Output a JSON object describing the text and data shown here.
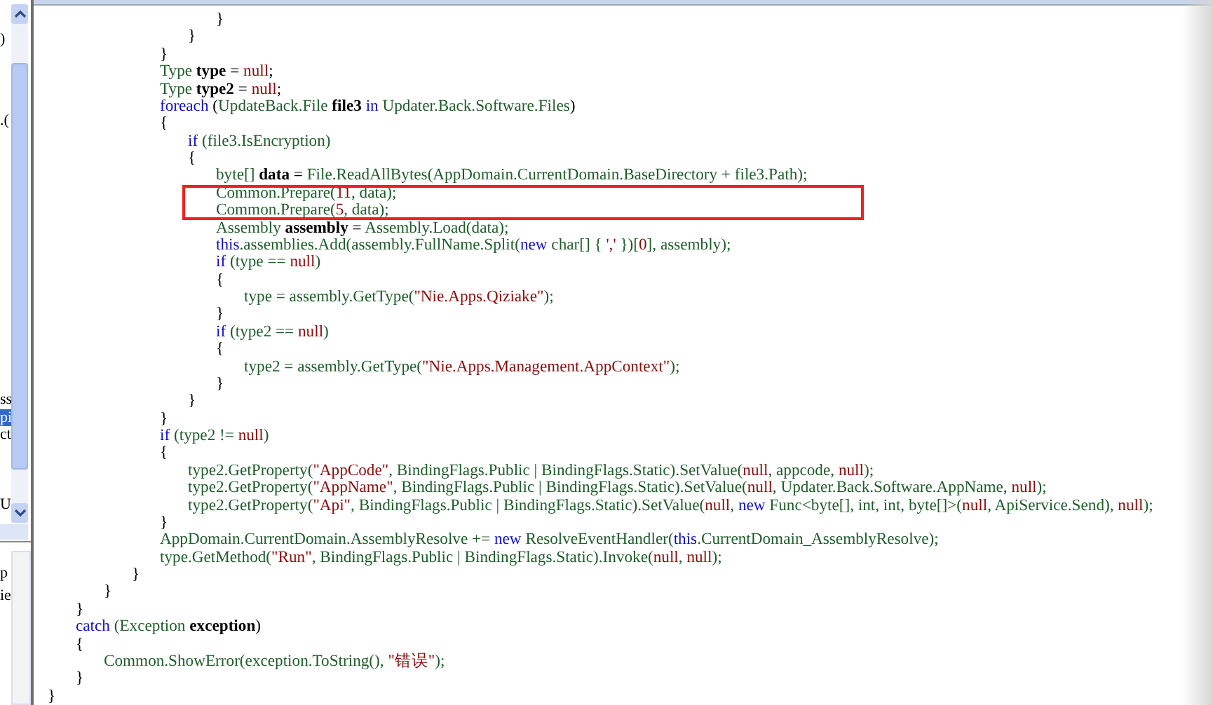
{
  "left_pane": {
    "fragments": [
      {
        "text": ")",
        "selected": false
      },
      {
        "text": ".(",
        "selected": false
      },
      {
        "text": "ss",
        "selected": false
      },
      {
        "text": "pi",
        "selected": true
      },
      {
        "text": "ct",
        "selected": false
      },
      {
        "text": "U",
        "selected": false
      }
    ]
  },
  "lower_pane": {
    "fragments": [
      {
        "text": "p"
      },
      {
        "text": "ie"
      }
    ]
  },
  "code": {
    "lines": [
      [
        {
          "t": "\t\t\t\t\t\t}",
          "kind": "plain"
        }
      ],
      [
        {
          "t": "\t\t\t\t\t}",
          "kind": "plain"
        }
      ],
      [
        {
          "t": "\t\t\t\t}",
          "kind": "plain"
        }
      ],
      [
        {
          "t": "\t\t\t\tType ",
          "kind": "ident"
        },
        {
          "t": "type",
          "kind": "decl"
        },
        {
          "t": " = ",
          "kind": "plain"
        },
        {
          "t": "null",
          "kind": "literal"
        },
        {
          "t": ";",
          "kind": "plain"
        }
      ],
      [
        {
          "t": "\t\t\t\tType ",
          "kind": "ident"
        },
        {
          "t": "type2",
          "kind": "decl"
        },
        {
          "t": " = ",
          "kind": "plain"
        },
        {
          "t": "null",
          "kind": "literal"
        },
        {
          "t": ";",
          "kind": "plain"
        }
      ],
      [
        {
          "t": "\t\t\t\tforeach",
          "kind": "keyword"
        },
        {
          "t": " (",
          "kind": "plain"
        },
        {
          "t": "UpdateBack.File ",
          "kind": "ident"
        },
        {
          "t": "file3 ",
          "kind": "decl"
        },
        {
          "t": "in ",
          "kind": "keyword"
        },
        {
          "t": "Updater.Back.Software.Files",
          "kind": "ident"
        },
        {
          "t": ")",
          "kind": "plain"
        }
      ],
      [
        {
          "t": "\t\t\t\t{",
          "kind": "plain"
        }
      ],
      [
        {
          "t": "\t\t\t\t\tif",
          "kind": "keyword"
        },
        {
          "t": " (file3.IsEncryption)",
          "kind": "ident"
        }
      ],
      [
        {
          "t": "\t\t\t\t\t{",
          "kind": "plain"
        }
      ],
      [
        {
          "t": "\t\t\t\t\t\tbyte[] ",
          "kind": "ident"
        },
        {
          "t": "data",
          "kind": "decl"
        },
        {
          "t": " = ",
          "kind": "plain"
        },
        {
          "t": "File.ReadAllBytes(AppDomain.CurrentDomain.BaseDirectory + file3.Path);",
          "kind": "ident"
        }
      ],
      [
        {
          "t": "\t\t\t\t\t\tCommon.Prepare(",
          "kind": "ident"
        },
        {
          "t": "11",
          "kind": "literal"
        },
        {
          "t": ", data);",
          "kind": "ident"
        }
      ],
      [
        {
          "t": "\t\t\t\t\t\tCommon.Prepare(",
          "kind": "ident"
        },
        {
          "t": "5",
          "kind": "literal"
        },
        {
          "t": ", data);",
          "kind": "ident"
        }
      ],
      [
        {
          "t": "\t\t\t\t\t\tAssembly ",
          "kind": "ident"
        },
        {
          "t": "assembly",
          "kind": "decl"
        },
        {
          "t": " = ",
          "kind": "plain"
        },
        {
          "t": "Assembly.Load(data);",
          "kind": "ident"
        }
      ],
      [
        {
          "t": "\t\t\t\t\t\tthis",
          "kind": "keyword"
        },
        {
          "t": ".assemblies.Add(assembly.FullName.Split(",
          "kind": "ident"
        },
        {
          "t": "new",
          "kind": "keyword"
        },
        {
          "t": " char[] { ",
          "kind": "ident"
        },
        {
          "t": "','",
          "kind": "literal"
        },
        {
          "t": " })[",
          "kind": "ident"
        },
        {
          "t": "0",
          "kind": "literal"
        },
        {
          "t": "], assembly);",
          "kind": "ident"
        }
      ],
      [
        {
          "t": "\t\t\t\t\t\tif",
          "kind": "keyword"
        },
        {
          "t": " (type == ",
          "kind": "ident"
        },
        {
          "t": "null",
          "kind": "literal"
        },
        {
          "t": ")",
          "kind": "ident"
        }
      ],
      [
        {
          "t": "\t\t\t\t\t\t{",
          "kind": "plain"
        }
      ],
      [
        {
          "t": "\t\t\t\t\t\t\ttype = assembly.GetType(",
          "kind": "ident"
        },
        {
          "t": "\"Nie.Apps.Qiziake\"",
          "kind": "literal"
        },
        {
          "t": ");",
          "kind": "ident"
        }
      ],
      [
        {
          "t": "\t\t\t\t\t\t}",
          "kind": "plain"
        }
      ],
      [
        {
          "t": "\t\t\t\t\t\tif",
          "kind": "keyword"
        },
        {
          "t": " (type2 == ",
          "kind": "ident"
        },
        {
          "t": "null",
          "kind": "literal"
        },
        {
          "t": ")",
          "kind": "ident"
        }
      ],
      [
        {
          "t": "\t\t\t\t\t\t{",
          "kind": "plain"
        }
      ],
      [
        {
          "t": "\t\t\t\t\t\t\ttype2 = assembly.GetType(",
          "kind": "ident"
        },
        {
          "t": "\"Nie.Apps.Management.AppContext\"",
          "kind": "literal"
        },
        {
          "t": ");",
          "kind": "ident"
        }
      ],
      [
        {
          "t": "\t\t\t\t\t\t}",
          "kind": "plain"
        }
      ],
      [
        {
          "t": "\t\t\t\t\t}",
          "kind": "plain"
        }
      ],
      [
        {
          "t": "\t\t\t\t}",
          "kind": "plain"
        }
      ],
      [
        {
          "t": "\t\t\t\tif",
          "kind": "keyword"
        },
        {
          "t": " (type2 != ",
          "kind": "ident"
        },
        {
          "t": "null",
          "kind": "literal"
        },
        {
          "t": ")",
          "kind": "ident"
        }
      ],
      [
        {
          "t": "\t\t\t\t{",
          "kind": "plain"
        }
      ],
      [
        {
          "t": "\t\t\t\t\ttype2.GetProperty(",
          "kind": "ident"
        },
        {
          "t": "\"AppCode\"",
          "kind": "literal"
        },
        {
          "t": ", BindingFlags.Public | BindingFlags.Static).SetValue(",
          "kind": "ident"
        },
        {
          "t": "null",
          "kind": "literal"
        },
        {
          "t": ", appcode, ",
          "kind": "ident"
        },
        {
          "t": "null",
          "kind": "literal"
        },
        {
          "t": ");",
          "kind": "ident"
        }
      ],
      [
        {
          "t": "\t\t\t\t\ttype2.GetProperty(",
          "kind": "ident"
        },
        {
          "t": "\"AppName\"",
          "kind": "literal"
        },
        {
          "t": ", BindingFlags.Public | BindingFlags.Static).SetValue(",
          "kind": "ident"
        },
        {
          "t": "null",
          "kind": "literal"
        },
        {
          "t": ", Updater.Back.Software.AppName, ",
          "kind": "ident"
        },
        {
          "t": "null",
          "kind": "literal"
        },
        {
          "t": ");",
          "kind": "ident"
        }
      ],
      [
        {
          "t": "\t\t\t\t\ttype2.GetProperty(",
          "kind": "ident"
        },
        {
          "t": "\"Api\"",
          "kind": "literal"
        },
        {
          "t": ", BindingFlags.Public | BindingFlags.Static).SetValue(",
          "kind": "ident"
        },
        {
          "t": "null",
          "kind": "literal"
        },
        {
          "t": ", ",
          "kind": "ident"
        },
        {
          "t": "new",
          "kind": "keyword"
        },
        {
          "t": " Func<byte[], int, int, byte[]>(",
          "kind": "ident"
        },
        {
          "t": "null",
          "kind": "literal"
        },
        {
          "t": ", ApiService.Send), ",
          "kind": "ident"
        },
        {
          "t": "null",
          "kind": "literal"
        },
        {
          "t": ");",
          "kind": "ident"
        }
      ],
      [
        {
          "t": "\t\t\t\t}",
          "kind": "plain"
        }
      ],
      [
        {
          "t": "\t\t\t\tAppDomain.CurrentDomain.AssemblyResolve += ",
          "kind": "ident"
        },
        {
          "t": "new",
          "kind": "keyword"
        },
        {
          "t": " ResolveEventHandler(",
          "kind": "ident"
        },
        {
          "t": "this",
          "kind": "keyword"
        },
        {
          "t": ".CurrentDomain_AssemblyResolve);",
          "kind": "ident"
        }
      ],
      [
        {
          "t": "\t\t\t\ttype.GetMethod(",
          "kind": "ident"
        },
        {
          "t": "\"Run\"",
          "kind": "literal"
        },
        {
          "t": ", BindingFlags.Public | BindingFlags.Static).Invoke(",
          "kind": "ident"
        },
        {
          "t": "null",
          "kind": "literal"
        },
        {
          "t": ", ",
          "kind": "ident"
        },
        {
          "t": "null",
          "kind": "literal"
        },
        {
          "t": ");",
          "kind": "ident"
        }
      ],
      [
        {
          "t": "\t\t\t}",
          "kind": "plain"
        }
      ],
      [
        {
          "t": "\t\t}",
          "kind": "plain"
        }
      ],
      [
        {
          "t": "\t}",
          "kind": "plain"
        }
      ],
      [
        {
          "t": "\tcatch",
          "kind": "keyword"
        },
        {
          "t": " (Exception ",
          "kind": "ident"
        },
        {
          "t": "exception",
          "kind": "decl"
        },
        {
          "t": ")",
          "kind": "plain"
        }
      ],
      [
        {
          "t": "\t{",
          "kind": "plain"
        }
      ],
      [
        {
          "t": "\t\tCommon.ShowError(exception.ToString(), ",
          "kind": "ident"
        },
        {
          "t": "\"错误\"",
          "kind": "literal"
        },
        {
          "t": ");",
          "kind": "ident"
        }
      ],
      [
        {
          "t": "\t}",
          "kind": "plain"
        }
      ],
      [
        {
          "t": "}",
          "kind": "plain"
        }
      ]
    ]
  }
}
